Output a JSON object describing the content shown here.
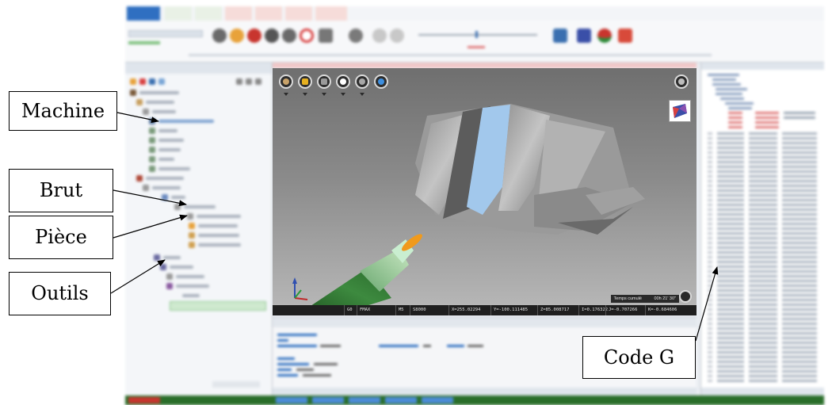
{
  "callouts": {
    "machine": "Machine",
    "brut": "Brut",
    "piece": "Pièce",
    "outils": "Outils",
    "code_g": "Code G"
  },
  "viewport_status": {
    "segments": [
      "G0",
      "FMAX",
      "M5",
      "S8000",
      "X=255.02294",
      "Y=-100.111485",
      "Z=85.008717",
      "I=0.176322",
      "J=-0.707266",
      "K=-0.684606"
    ],
    "elapsed_label": "Temps cumulé",
    "elapsed_value": "00h 21' 30\""
  },
  "colors": {
    "ribbon_red": "#c8352e",
    "accent_blue": "#2f6fc1",
    "tool_green": "#2d6b2e",
    "tool_orange": "#f09a1c",
    "part_blue": "#9fc6ec"
  },
  "icons": [
    "rotate-view-icon",
    "cube-view-icon",
    "database-icon",
    "zoom-icon",
    "settings-icon",
    "globe-icon",
    "camera-icon",
    "orientation-cube-icon"
  ]
}
